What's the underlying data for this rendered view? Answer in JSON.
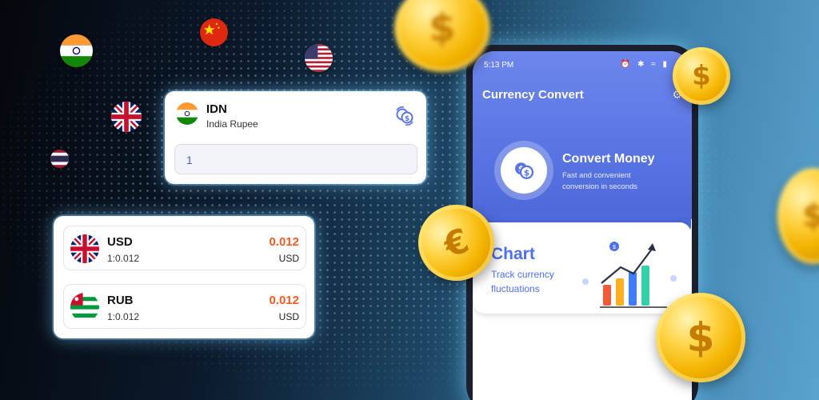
{
  "flags": [
    "india-flag",
    "china-flag",
    "usa-flag",
    "uk-flag",
    "thailand-flag"
  ],
  "input_card": {
    "code": "IDN",
    "name": "India Rupee",
    "amount": "1"
  },
  "rates": [
    {
      "code": "USD",
      "ratio": "1:0.012",
      "value": "0.012",
      "unit": "USD"
    },
    {
      "code": "RUB",
      "ratio": "1:0.012",
      "value": "0.012",
      "unit": "USD"
    }
  ],
  "phone": {
    "time": "5:13 PM",
    "title": "Currency Convert",
    "convert": {
      "title": "Convert Money",
      "desc1": "Fast and convenient",
      "desc2": "conversion in seconds"
    },
    "chart": {
      "title": "Chart",
      "desc1": "Track currency",
      "desc2": "fluctuations"
    }
  },
  "colors": {
    "accent": "#f15a24",
    "brand": "#5a74e4",
    "chart_blue": "#4f6ef0"
  }
}
